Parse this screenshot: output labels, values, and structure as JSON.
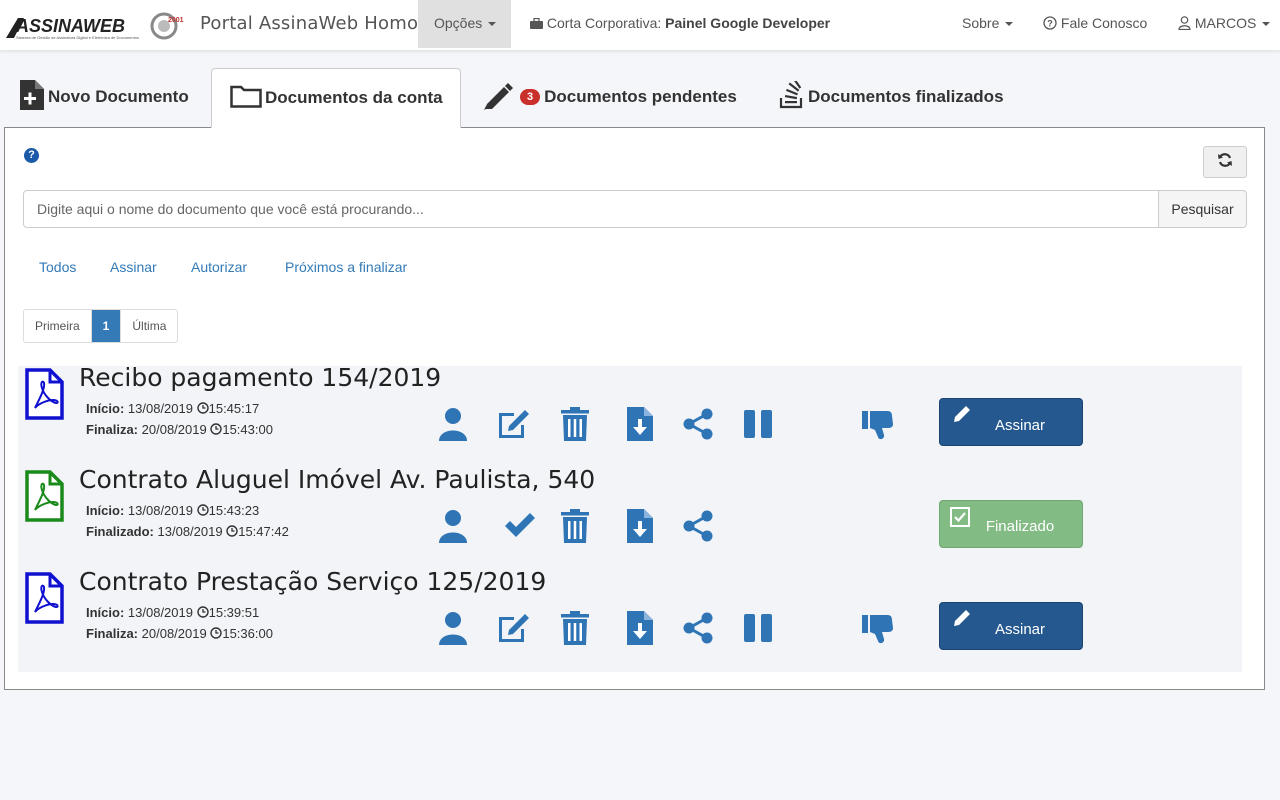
{
  "navbar": {
    "logo_text": "ASSINAWEB",
    "brand": "Portal AssinaWeb Homol",
    "opcoes": "Opções",
    "conta_label": "Corta Corporativa:",
    "conta_value": "Painel Google Developer",
    "sobre": "Sobre",
    "fale": "Fale Conosco",
    "user": "MARCOS"
  },
  "tabs": [
    {
      "label": "Novo Documento"
    },
    {
      "label": "Documentos da conta"
    },
    {
      "label": "Documentos pendentes",
      "badge": "3"
    },
    {
      "label": "Documentos finalizados"
    }
  ],
  "search": {
    "placeholder": "Digite aqui o nome do documento que você está procurando...",
    "button": "Pesquisar"
  },
  "filters": [
    "Todos",
    "Assinar",
    "Autorizar",
    "Próximos a finalizar"
  ],
  "pager": {
    "first": "Primeira",
    "current": "1",
    "last": "Última"
  },
  "documents": [
    {
      "title": "Recibo pagamento 154/2019",
      "start_label": "Início:",
      "start_date": "13/08/2019",
      "start_time": "15:45:17",
      "end_label": "Finaliza:",
      "end_date": "20/08/2019",
      "end_time": "15:43:00",
      "action": "Assinar",
      "status": "pending"
    },
    {
      "title": "Contrato Aluguel Imóvel Av. Paulista, 540",
      "start_label": "Início:",
      "start_date": "13/08/2019",
      "start_time": "15:43:23",
      "end_label": "Finalizado:",
      "end_date": "13/08/2019",
      "end_time": "15:47:42",
      "action": "Finalizado",
      "status": "done"
    },
    {
      "title": "Contrato Prestação Serviço 125/2019",
      "start_label": "Início:",
      "start_date": "13/08/2019",
      "start_time": "15:39:51",
      "end_label": "Finaliza:",
      "end_date": "20/08/2019",
      "end_time": "15:36:00",
      "action": "Assinar",
      "status": "pending"
    }
  ],
  "colors": {
    "accent": "#337ab7",
    "icon": "#2f74b5",
    "pdf_pending": "#1010d0",
    "pdf_done": "#1a8a1a",
    "assinar": "#25588f",
    "finalizado": "#82bb84"
  }
}
